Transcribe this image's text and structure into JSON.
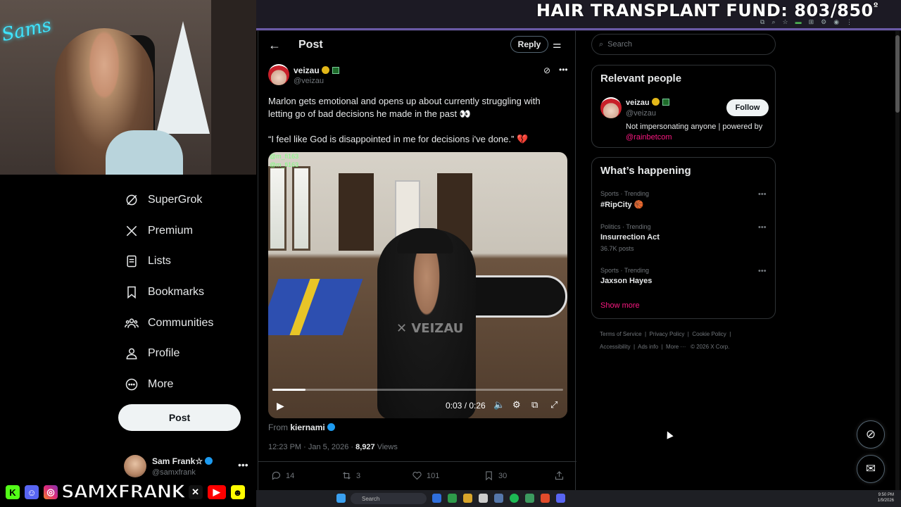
{
  "overlay": {
    "fund_text": "HAIR TRANSPLANT FUND: 803/850",
    "fund_suffix": "º",
    "webcam_neon": "Sams",
    "social_handle": "SAMXFRANK"
  },
  "nav": {
    "items": [
      {
        "label": "SuperGrok",
        "icon": "grok-icon"
      },
      {
        "label": "Premium",
        "icon": "x-logo-icon"
      },
      {
        "label": "Lists",
        "icon": "list-icon"
      },
      {
        "label": "Bookmarks",
        "icon": "bookmark-icon"
      },
      {
        "label": "Communities",
        "icon": "communities-icon"
      },
      {
        "label": "Profile",
        "icon": "person-icon"
      },
      {
        "label": "More",
        "icon": "more-circle-icon"
      }
    ],
    "post_label": "Post",
    "account": {
      "name": "Sam Frank☆",
      "handle": "@samxfrank"
    }
  },
  "post": {
    "header_title": "Post",
    "reply_label": "Reply",
    "author_name": "veizau",
    "author_handle": "@veizau",
    "text_line1": "Marlon gets emotional and opens up about currently struggling with letting go of bad decisions he made in the past 👀",
    "text_line2": "“I feel like God is disappointed in me for decisions i've done.” 💔",
    "video": {
      "watermark": "✕ VEIZAU",
      "overlay_tag_1": "@m_fi163",
      "overlay_tag_2": "@m_fi163",
      "time": "0:03 / 0:26",
      "progress": 0.115
    },
    "from_label": "From",
    "from_name": "kiernami",
    "time_date": "12:23 PM · Jan 5, 2026 · ",
    "views_count": "8,927",
    "views_label": " Views",
    "actions": {
      "replies": "14",
      "reposts": "3",
      "likes": "101",
      "bookmarks": "30"
    }
  },
  "sidebar": {
    "search_placeholder": "Search",
    "relevant_title": "Relevant people",
    "relevant": {
      "name": "veizau",
      "handle": "@veizau",
      "follow_label": "Follow",
      "bio_text": "Not impersonating anyone | powered by ",
      "bio_link": "@rainbetcom"
    },
    "happening_title": "What’s happening",
    "trends": [
      {
        "category": "Sports · Trending",
        "name": "#RipCity 🏀",
        "posts": ""
      },
      {
        "category": "Politics · Trending",
        "name": "Insurrection Act",
        "posts": "36.7K posts"
      },
      {
        "category": "Sports · Trending",
        "name": "Jaxson Hayes",
        "posts": ""
      }
    ],
    "show_more": "Show more",
    "footer": {
      "terms": "Terms of Service",
      "privacy": "Privacy Policy",
      "cookie": "Cookie Policy",
      "accessibility": "Accessibility",
      "ads": "Ads info",
      "more": "More ···",
      "copyright": "© 2026 X Corp."
    }
  },
  "taskbar": {
    "search_label": "Search",
    "clock_time": "9:50 PM",
    "clock_date": "1/9/2026"
  },
  "colors": {
    "accent_pink": "#f91880",
    "verified_gold": "#e2b719",
    "verified_blue": "#1d9bf0"
  }
}
